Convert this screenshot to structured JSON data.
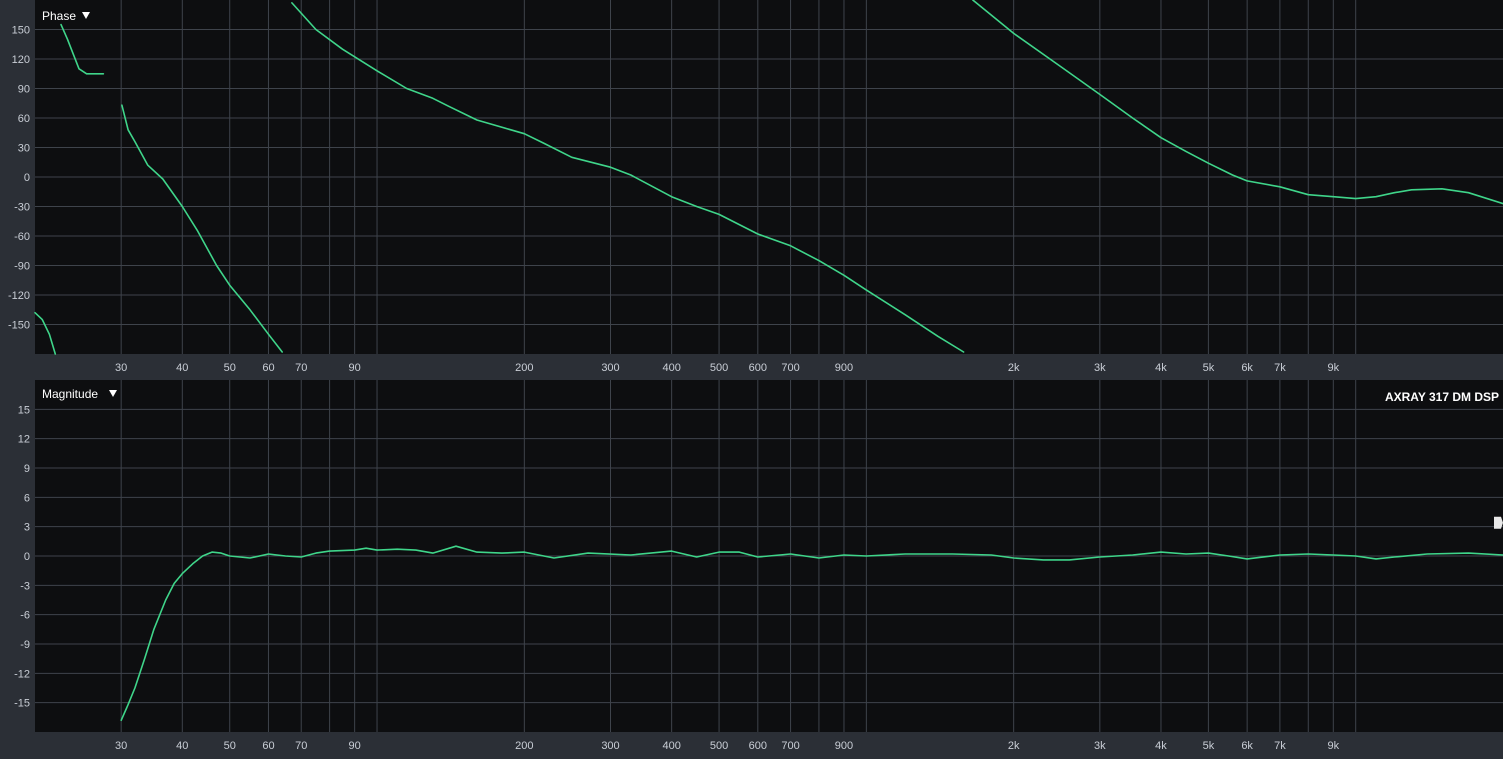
{
  "colors": {
    "trace": "#3fd58a",
    "plot_bg": "#0d0e10",
    "frame": "#2b2f36"
  },
  "phase_panel": {
    "title": "Phase",
    "menu_icon": "triangle-down-icon"
  },
  "magnitude_panel": {
    "title": "Magnitude",
    "menu_icon": "triangle-down-icon",
    "model": "AXRAY 317 DM DSP",
    "handle_icon": "marker-handle-icon"
  },
  "chart_data": [
    {
      "type": "line",
      "name": "phase",
      "xscale": "log",
      "xlim": [
        20,
        20000
      ],
      "ylim": [
        -180,
        180
      ],
      "yticks": [
        150,
        120,
        90,
        60,
        30,
        0,
        -30,
        -60,
        -90,
        -120,
        -150
      ],
      "xticks": [
        {
          "v": 30,
          "label": "30"
        },
        {
          "v": 40,
          "label": "40"
        },
        {
          "v": 50,
          "label": "50"
        },
        {
          "v": 60,
          "label": "60"
        },
        {
          "v": 70,
          "label": "70"
        },
        {
          "v": 90,
          "label": "90"
        },
        {
          "v": 200,
          "label": "200"
        },
        {
          "v": 300,
          "label": "300"
        },
        {
          "v": 400,
          "label": "400"
        },
        {
          "v": 500,
          "label": "500"
        },
        {
          "v": 600,
          "label": "600"
        },
        {
          "v": 700,
          "label": "700"
        },
        {
          "v": 900,
          "label": "900"
        },
        {
          "v": 2000,
          "label": "2k"
        },
        {
          "v": 3000,
          "label": "3k"
        },
        {
          "v": 4000,
          "label": "4k"
        },
        {
          "v": 5000,
          "label": "5k"
        },
        {
          "v": 6000,
          "label": "6k"
        },
        {
          "v": 7000,
          "label": "7k"
        },
        {
          "v": 9000,
          "label": "9k"
        }
      ],
      "grid": true,
      "segments": [
        [
          [
            20,
            -138
          ],
          [
            20.7,
            -145
          ],
          [
            21.4,
            -160
          ],
          [
            22,
            -180
          ]
        ],
        [
          [
            22.6,
            155
          ],
          [
            23.3,
            140
          ],
          [
            24.6,
            110
          ],
          [
            25.5,
            105
          ],
          [
            27.6,
            105
          ]
        ],
        [
          [
            30.1,
            73
          ],
          [
            31,
            48
          ],
          [
            32,
            36
          ],
          [
            34,
            12
          ],
          [
            36.5,
            -2
          ],
          [
            40,
            -30
          ],
          [
            43,
            -55
          ],
          [
            47,
            -90
          ],
          [
            50,
            -110
          ],
          [
            55,
            -135
          ],
          [
            60,
            -160
          ],
          [
            64,
            -178
          ]
        ],
        [
          [
            67,
            177
          ],
          [
            75,
            150
          ],
          [
            85,
            130
          ],
          [
            100,
            108
          ],
          [
            115,
            90
          ],
          [
            130,
            80
          ],
          [
            140,
            72
          ],
          [
            160,
            58
          ],
          [
            200,
            44
          ],
          [
            220,
            34
          ],
          [
            250,
            20
          ],
          [
            300,
            10
          ],
          [
            330,
            2
          ],
          [
            400,
            -20
          ],
          [
            450,
            -30
          ],
          [
            500,
            -38
          ],
          [
            600,
            -58
          ],
          [
            700,
            -70
          ],
          [
            800,
            -85
          ],
          [
            900,
            -100
          ],
          [
            1000,
            -115
          ],
          [
            1200,
            -140
          ],
          [
            1400,
            -162
          ],
          [
            1580,
            -178
          ]
        ],
        [
          [
            1650,
            180
          ],
          [
            2000,
            146
          ],
          [
            2500,
            112
          ],
          [
            3000,
            84
          ],
          [
            3500,
            60
          ],
          [
            4000,
            40
          ],
          [
            4500,
            26
          ],
          [
            5000,
            14
          ],
          [
            5600,
            2
          ],
          [
            6000,
            -4
          ],
          [
            7000,
            -10
          ],
          [
            8000,
            -18
          ],
          [
            9000,
            -20
          ],
          [
            10000,
            -22
          ],
          [
            11000,
            -20
          ],
          [
            12000,
            -16
          ],
          [
            13000,
            -13
          ],
          [
            15000,
            -12
          ],
          [
            17000,
            -16
          ],
          [
            20000,
            -27
          ]
        ]
      ]
    },
    {
      "type": "line",
      "name": "magnitude",
      "xscale": "log",
      "xlim": [
        20,
        20000
      ],
      "ylim": [
        -18,
        18
      ],
      "yticks": [
        15,
        12,
        9,
        6,
        3,
        0,
        -3,
        -6,
        -9,
        -12,
        -15
      ],
      "xticks": [
        {
          "v": 30,
          "label": "30"
        },
        {
          "v": 40,
          "label": "40"
        },
        {
          "v": 50,
          "label": "50"
        },
        {
          "v": 60,
          "label": "60"
        },
        {
          "v": 70,
          "label": "70"
        },
        {
          "v": 90,
          "label": "90"
        },
        {
          "v": 200,
          "label": "200"
        },
        {
          "v": 300,
          "label": "300"
        },
        {
          "v": 400,
          "label": "400"
        },
        {
          "v": 500,
          "label": "500"
        },
        {
          "v": 600,
          "label": "600"
        },
        {
          "v": 700,
          "label": "700"
        },
        {
          "v": 900,
          "label": "900"
        },
        {
          "v": 2000,
          "label": "2k"
        },
        {
          "v": 3000,
          "label": "3k"
        },
        {
          "v": 4000,
          "label": "4k"
        },
        {
          "v": 5000,
          "label": "5k"
        },
        {
          "v": 6000,
          "label": "6k"
        },
        {
          "v": 7000,
          "label": "7k"
        },
        {
          "v": 9000,
          "label": "9k"
        }
      ],
      "grid": true,
      "marker_db": 3.4,
      "segments": [
        [
          [
            30,
            -16.8
          ],
          [
            31,
            -15.2
          ],
          [
            32,
            -13.5
          ],
          [
            33.5,
            -10.5
          ],
          [
            35,
            -7.5
          ],
          [
            37,
            -4.5
          ],
          [
            38.5,
            -2.8
          ],
          [
            40,
            -1.8
          ],
          [
            42,
            -0.8
          ],
          [
            44,
            0
          ],
          [
            46,
            0.4
          ],
          [
            48,
            0.3
          ],
          [
            50,
            0
          ],
          [
            55,
            -0.2
          ],
          [
            60,
            0.2
          ],
          [
            65,
            0
          ],
          [
            70,
            -0.1
          ],
          [
            75,
            0.3
          ],
          [
            80,
            0.5
          ],
          [
            90,
            0.6
          ],
          [
            95,
            0.8
          ],
          [
            100,
            0.6
          ],
          [
            110,
            0.7
          ],
          [
            120,
            0.6
          ],
          [
            130,
            0.3
          ],
          [
            145,
            1.0
          ],
          [
            160,
            0.4
          ],
          [
            180,
            0.3
          ],
          [
            200,
            0.4
          ],
          [
            230,
            -0.2
          ],
          [
            270,
            0.3
          ],
          [
            330,
            0.1
          ],
          [
            400,
            0.5
          ],
          [
            450,
            -0.1
          ],
          [
            500,
            0.4
          ],
          [
            550,
            0.4
          ],
          [
            600,
            -0.1
          ],
          [
            700,
            0.2
          ],
          [
            800,
            -0.2
          ],
          [
            900,
            0.1
          ],
          [
            1000,
            0
          ],
          [
            1200,
            0.2
          ],
          [
            1500,
            0.2
          ],
          [
            1800,
            0.1
          ],
          [
            2000,
            -0.2
          ],
          [
            2300,
            -0.4
          ],
          [
            2600,
            -0.4
          ],
          [
            3000,
            -0.1
          ],
          [
            3500,
            0.1
          ],
          [
            4000,
            0.4
          ],
          [
            4500,
            0.2
          ],
          [
            5000,
            0.3
          ],
          [
            5500,
            0
          ],
          [
            6000,
            -0.3
          ],
          [
            7000,
            0.1
          ],
          [
            8000,
            0.2
          ],
          [
            9000,
            0.1
          ],
          [
            10000,
            0
          ],
          [
            11000,
            -0.3
          ],
          [
            12000,
            -0.1
          ],
          [
            14000,
            0.2
          ],
          [
            17000,
            0.3
          ],
          [
            20000,
            0.1
          ]
        ]
      ]
    }
  ]
}
